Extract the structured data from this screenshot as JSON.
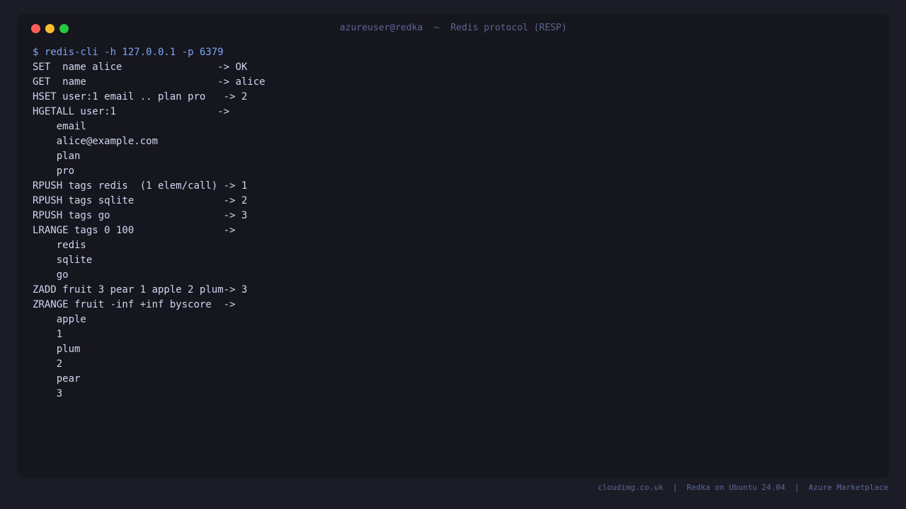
{
  "window": {
    "title": "azureuser@redka  ~  Redis protocol (RESP)",
    "controls": {
      "close_color": "#ff5f57",
      "minimize_color": "#febc2e",
      "maximize_color": "#28c840"
    }
  },
  "terminal": {
    "prompt": "$ redis-cli -h 127.0.0.1 -p 6379",
    "lines": [
      "SET  name alice                -> OK",
      "GET  name                      -> alice",
      "HSET user:1 email .. plan pro   -> 2",
      "HGETALL user:1                 ->",
      "    email",
      "    alice@example.com",
      "    plan",
      "    pro",
      "RPUSH tags redis  (1 elem/call) -> 1",
      "RPUSH tags sqlite               -> 2",
      "RPUSH tags go                   -> 3",
      "LRANGE tags 0 100               ->",
      "    redis",
      "    sqlite",
      "    go",
      "ZADD fruit 3 pear 1 apple 2 plum-> 3",
      "ZRANGE fruit -inf +inf byscore  ->",
      "    apple",
      "    1",
      "    plum",
      "    2",
      "    pear",
      "    3"
    ]
  },
  "footer": {
    "text": "cloudimg.co.uk  |  Redka on Ubuntu 24.04  |  Azure Marketplace"
  },
  "colors": {
    "background": "#1c1c27",
    "terminal_background": "#16161e",
    "prompt": "#7fa4f5",
    "text": "#d1d6f0",
    "muted": "#5c6794"
  }
}
